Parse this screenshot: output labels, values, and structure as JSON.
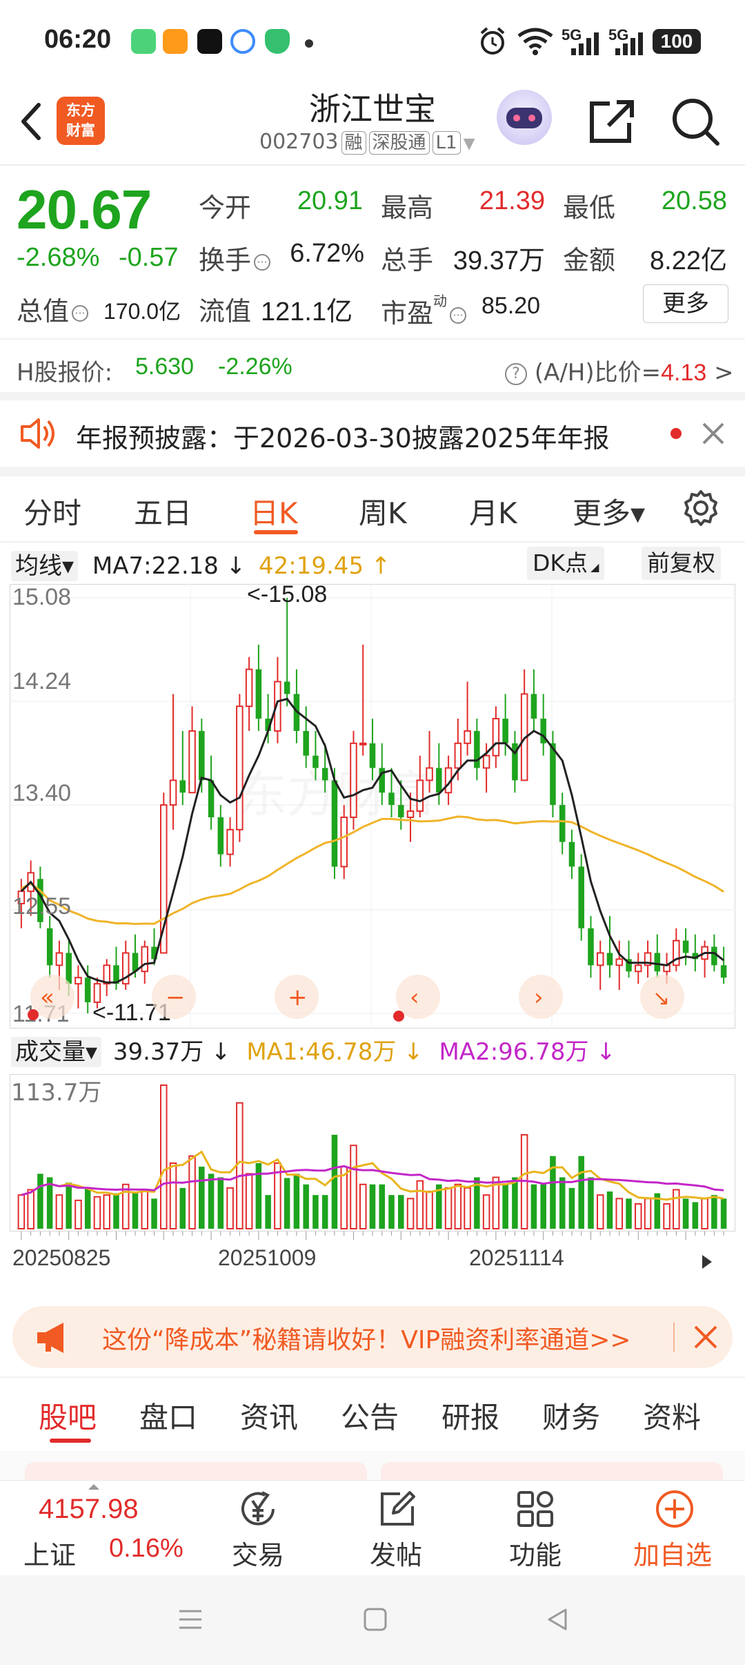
{
  "status_bar": {
    "time": "06:20",
    "battery": "100",
    "net1": "5G",
    "net2": "5G"
  },
  "header": {
    "logo_line1": "东方",
    "logo_line2": "财富",
    "stock_name": "浙江世宝",
    "stock_code": "002703",
    "tag_margin": "融",
    "tag_connect": "深股通",
    "tag_level": "L1"
  },
  "quote": {
    "price": "20.67",
    "change_pct": "-2.68%",
    "change_amt": "-0.57",
    "open_label": "今开",
    "open_value": "20.91",
    "high_label": "最高",
    "high_value": "21.39",
    "low_label": "最低",
    "low_value": "20.58",
    "turnover_label": "换手",
    "turnover_value": "6.72%",
    "volume_label": "总手",
    "volume_value": "39.37万",
    "amount_label": "金额",
    "amount_value": "8.22亿",
    "total_value_label": "总值",
    "total_value": "170.0亿",
    "float_value_label": "流值",
    "float_value": "121.1亿",
    "pe_label": "市盈",
    "pe_sup": "动",
    "pe_value": "85.20",
    "more_label": "更多"
  },
  "h_share": {
    "label": "H股报价:",
    "price": "5.630",
    "change": "-2.26%",
    "ah_label": "(A/H)比价=",
    "ah_value": "4.13",
    "ah_arrow": ">"
  },
  "notice": {
    "text": "年报预披露：于2026-03-30披露2025年年报"
  },
  "chart_tabs": [
    {
      "label": "分时",
      "active": false
    },
    {
      "label": "五日",
      "active": false
    },
    {
      "label": "日K",
      "active": true
    },
    {
      "label": "周K",
      "active": false
    },
    {
      "label": "月K",
      "active": false
    },
    {
      "label": "更多▾",
      "active": false
    }
  ],
  "ma_bar": {
    "indicator": "均线▾",
    "ma7": "MA7:22.18 ↓",
    "ma42": "42:19.45 ↑",
    "dk_label": "DK点",
    "adjust_label": "前复权"
  },
  "kline_axis": {
    "y_labels": [
      "15.08",
      "14.24",
      "13.40",
      "12.55",
      "11.71"
    ],
    "max_annotation": "<-15.08",
    "min_annotation": "<-11.71"
  },
  "vol_bar": {
    "indicator": "成交量▾",
    "vol": "39.37万 ↓",
    "ma1": "MA1:46.78万 ↓",
    "ma2": "MA2:96.78万 ↓",
    "max_label": "113.7万"
  },
  "dates": [
    "20250825",
    "20251009",
    "20251114"
  ],
  "colors": {
    "up": "#e22b2b",
    "down": "#1ea41e",
    "accent": "#f15a22",
    "ma_short": "#222222",
    "ma_long": "#f0b429",
    "vol_ma2": "#c326c8"
  },
  "chart_data": {
    "type": "candlestick",
    "title": "",
    "ylim": [
      11.71,
      15.08
    ],
    "y_ticks": [
      15.08,
      14.24,
      13.4,
      12.55,
      11.71
    ],
    "x_tick_labels": [
      "20250825",
      "20251009",
      "20251114"
    ],
    "series": [
      {
        "name": "MA7"
      },
      {
        "name": "42"
      }
    ],
    "volume": {
      "max": "113.7万",
      "series": [
        {
          "name": "MA1"
        },
        {
          "name": "MA2"
        }
      ]
    },
    "candles": [
      [
        12.6,
        12.8,
        12.4,
        12.7
      ],
      [
        12.7,
        12.95,
        12.5,
        12.85
      ],
      [
        12.8,
        12.9,
        12.4,
        12.45
      ],
      [
        12.4,
        12.5,
        12.0,
        12.1
      ],
      [
        12.1,
        12.3,
        11.9,
        12.2
      ],
      [
        12.2,
        12.3,
        11.85,
        11.95
      ],
      [
        11.95,
        12.1,
        11.75,
        12.0
      ],
      [
        12.0,
        12.1,
        11.71,
        11.8
      ],
      [
        11.8,
        12.0,
        11.75,
        11.95
      ],
      [
        11.95,
        12.15,
        11.85,
        12.1
      ],
      [
        12.1,
        12.25,
        11.9,
        11.95
      ],
      [
        11.95,
        12.3,
        11.9,
        12.2
      ],
      [
        12.2,
        12.35,
        12.0,
        12.05
      ],
      [
        12.05,
        12.3,
        11.95,
        12.25
      ],
      [
        12.25,
        12.4,
        12.1,
        12.15
      ],
      [
        12.2,
        13.5,
        12.2,
        13.4
      ],
      [
        13.4,
        14.3,
        13.2,
        13.6
      ],
      [
        13.6,
        14.0,
        13.4,
        13.5
      ],
      [
        13.5,
        14.2,
        13.5,
        14.0
      ],
      [
        14.0,
        14.1,
        13.5,
        13.6
      ],
      [
        13.6,
        13.8,
        13.2,
        13.3
      ],
      [
        13.3,
        13.4,
        12.9,
        13.0
      ],
      [
        13.0,
        13.3,
        12.9,
        13.2
      ],
      [
        13.2,
        14.3,
        13.1,
        14.2
      ],
      [
        14.2,
        14.6,
        14.0,
        14.5
      ],
      [
        14.5,
        14.7,
        14.0,
        14.1
      ],
      [
        14.1,
        14.3,
        13.9,
        14.0
      ],
      [
        14.0,
        14.6,
        13.9,
        14.4
      ],
      [
        14.4,
        15.08,
        14.2,
        14.3
      ],
      [
        14.3,
        14.5,
        13.9,
        14.0
      ],
      [
        14.0,
        14.2,
        13.7,
        13.8
      ],
      [
        13.8,
        14.0,
        13.6,
        13.7
      ],
      [
        13.7,
        13.9,
        13.5,
        13.6
      ],
      [
        13.6,
        13.7,
        12.8,
        12.9
      ],
      [
        12.9,
        13.4,
        12.8,
        13.3
      ],
      [
        13.3,
        14.0,
        13.2,
        13.9
      ],
      [
        13.9,
        14.7,
        13.8,
        13.9
      ],
      [
        13.9,
        14.1,
        13.6,
        13.7
      ],
      [
        13.7,
        13.9,
        13.4,
        13.5
      ],
      [
        13.5,
        13.7,
        13.3,
        13.4
      ],
      [
        13.4,
        13.6,
        13.2,
        13.3
      ],
      [
        13.3,
        13.5,
        13.1,
        13.35
      ],
      [
        13.35,
        13.8,
        13.3,
        13.6
      ],
      [
        13.6,
        14.0,
        13.5,
        13.7
      ],
      [
        13.7,
        13.9,
        13.4,
        13.5
      ],
      [
        13.5,
        13.8,
        13.4,
        13.7
      ],
      [
        13.7,
        14.1,
        13.6,
        13.9
      ],
      [
        13.9,
        14.4,
        13.8,
        14.0
      ],
      [
        14.0,
        14.1,
        13.6,
        13.7
      ],
      [
        13.7,
        13.9,
        13.5,
        13.8
      ],
      [
        13.8,
        14.2,
        13.7,
        14.1
      ],
      [
        14.1,
        14.3,
        13.8,
        13.9
      ],
      [
        13.9,
        14.0,
        13.5,
        13.6
      ],
      [
        13.6,
        14.5,
        13.6,
        14.3
      ],
      [
        14.3,
        14.5,
        14.0,
        14.1
      ],
      [
        14.1,
        14.3,
        13.8,
        13.9
      ],
      [
        13.9,
        14.0,
        13.3,
        13.4
      ],
      [
        13.4,
        13.5,
        13.0,
        13.1
      ],
      [
        13.1,
        13.2,
        12.8,
        12.9
      ],
      [
        12.9,
        13.0,
        12.3,
        12.4
      ],
      [
        12.4,
        12.5,
        12.0,
        12.1
      ],
      [
        12.1,
        12.3,
        11.9,
        12.2
      ],
      [
        12.2,
        12.5,
        12.0,
        12.1
      ],
      [
        12.1,
        12.3,
        11.9,
        12.15
      ],
      [
        12.15,
        12.3,
        12.0,
        12.05
      ],
      [
        12.05,
        12.2,
        11.95,
        12.1
      ],
      [
        12.1,
        12.3,
        12.0,
        12.2
      ],
      [
        12.2,
        12.35,
        12.0,
        12.05
      ],
      [
        12.05,
        12.2,
        11.95,
        12.1
      ],
      [
        12.1,
        12.4,
        12.05,
        12.3
      ],
      [
        12.3,
        12.4,
        12.1,
        12.2
      ],
      [
        12.2,
        12.35,
        12.05,
        12.15
      ],
      [
        12.15,
        12.3,
        12.0,
        12.25
      ],
      [
        12.25,
        12.35,
        12.05,
        12.1
      ],
      [
        12.1,
        12.25,
        11.95,
        12.0
      ]
    ]
  },
  "promo": {
    "text": "这份“降成本”秘籍请收好！VIP融资利率通道>>"
  },
  "bottom_tabs": [
    {
      "label": "股吧",
      "active": true
    },
    {
      "label": "盘口",
      "active": false
    },
    {
      "label": "资讯",
      "active": false
    },
    {
      "label": "公告",
      "active": false
    },
    {
      "label": "研报",
      "active": false
    },
    {
      "label": "财务",
      "active": false
    },
    {
      "label": "资料",
      "active": false
    }
  ],
  "bottom_bar": {
    "index_value": "4157.98",
    "index_name": "上证",
    "index_pct": "0.16%",
    "trade_label": "交易",
    "post_label": "发帖",
    "func_label": "功能",
    "add_label": "加自选"
  }
}
